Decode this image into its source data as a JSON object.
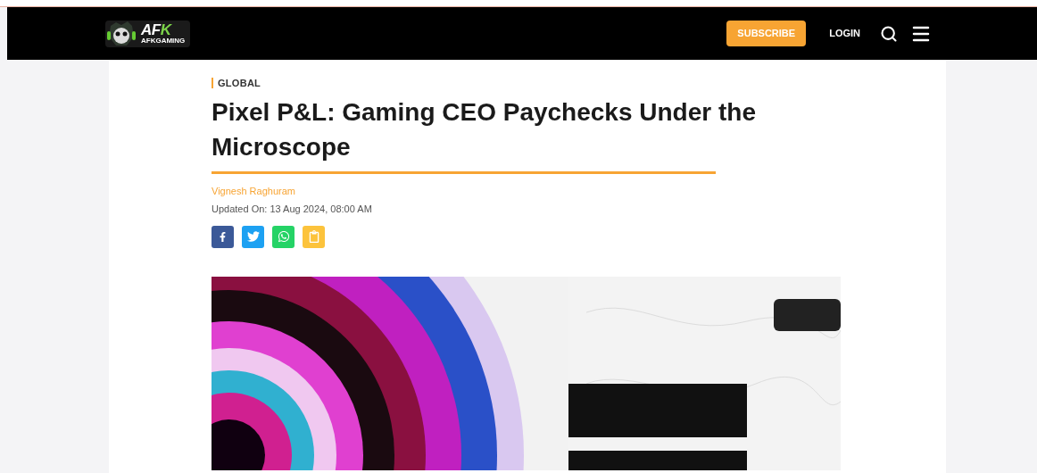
{
  "header": {
    "logo": {
      "mark": "AF",
      "mark_accent": "K",
      "name": "AFKGAMING"
    },
    "subscribe": "SUBSCRIBE",
    "login": "LOGIN"
  },
  "article": {
    "category": "GLOBAL",
    "title": "Pixel P&L: Gaming CEO Paychecks Under the Microscope",
    "author": "Vignesh Raghuram",
    "updated": "Updated On: 13 Aug 2024, 08:00 AM",
    "share": [
      {
        "kind": "facebook",
        "color": "#3b5998"
      },
      {
        "kind": "twitter",
        "color": "#1da1f2"
      },
      {
        "kind": "whatsapp",
        "color": "#25d366"
      },
      {
        "kind": "copy",
        "color": "#fcc33c"
      }
    ]
  }
}
